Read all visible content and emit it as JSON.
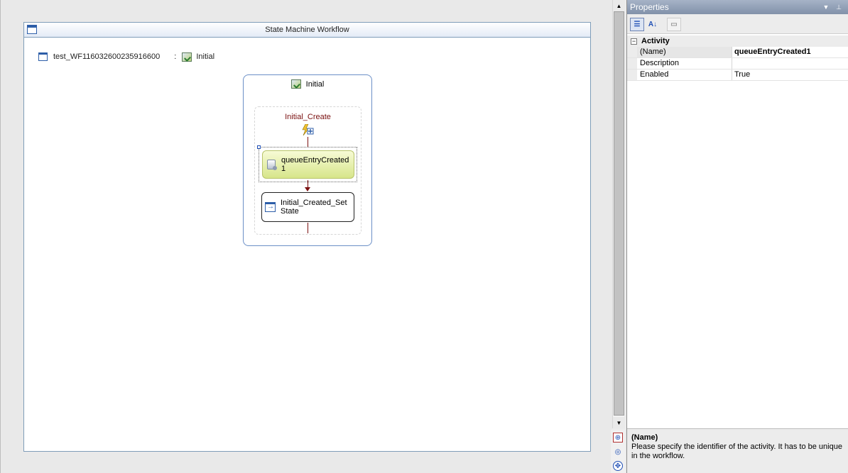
{
  "designer": {
    "title": "State Machine Workflow",
    "workflow_name": "test_WF116032600235916600",
    "separator": ":",
    "initial_state": "Initial"
  },
  "state": {
    "title": "Initial",
    "event_driven": "Initial_Create",
    "activity": "queueEntryCreated1",
    "set_state": "Initial_Created_SetState"
  },
  "properties": {
    "title": "Properties",
    "category": "Activity",
    "rows": [
      {
        "name": "(Name)",
        "value": "queueEntryCreated1"
      },
      {
        "name": "Description",
        "value": ""
      },
      {
        "name": "Enabled",
        "value": "True"
      }
    ],
    "description_title": "(Name)",
    "description_text": "Please specify the identifier of the activity. It has to be unique in the workflow."
  },
  "icons": {
    "dropdown": "dropdown-arrow-icon",
    "pin": "pin-icon",
    "categorized": "categorized-icon",
    "alphabetical": "alphabetical-sort-icon",
    "property_pages": "property-pages-icon"
  }
}
